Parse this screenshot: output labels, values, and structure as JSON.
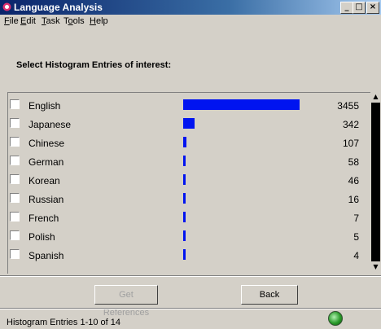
{
  "window": {
    "title": "Language Analysis",
    "minimize": "_",
    "maximize": "□",
    "close": "×"
  },
  "menu": [
    "File",
    "Edit",
    "Task",
    "Tools",
    "Help"
  ],
  "prompt": "Select Histogram Entries of interest:",
  "histogram": [
    {
      "label": "English",
      "count": "3455",
      "value": 3455,
      "checked": false
    },
    {
      "label": "Japanese",
      "count": "342",
      "value": 342,
      "checked": false
    },
    {
      "label": "Chinese",
      "count": "107",
      "value": 107,
      "checked": false
    },
    {
      "label": "German",
      "count": "58",
      "value": 58,
      "checked": false
    },
    {
      "label": "Korean",
      "count": "46",
      "value": 46,
      "checked": false
    },
    {
      "label": "Russian",
      "count": "16",
      "value": 16,
      "checked": false
    },
    {
      "label": "French",
      "count": "7",
      "value": 7,
      "checked": false
    },
    {
      "label": "Polish",
      "count": "5",
      "value": 5,
      "checked": false
    },
    {
      "label": "Spanish",
      "count": "4",
      "value": 4,
      "checked": false
    }
  ],
  "buttons": {
    "get_references": "Get References",
    "back": "Back"
  },
  "status": {
    "text": "Histogram Entries 1-10 of 14"
  },
  "colors": {
    "bar": "#0014f0",
    "titlebar": "#0a246a",
    "background": "#d4d0c8"
  },
  "icons": {
    "title": "app-icon",
    "status": "status-ok-icon"
  }
}
